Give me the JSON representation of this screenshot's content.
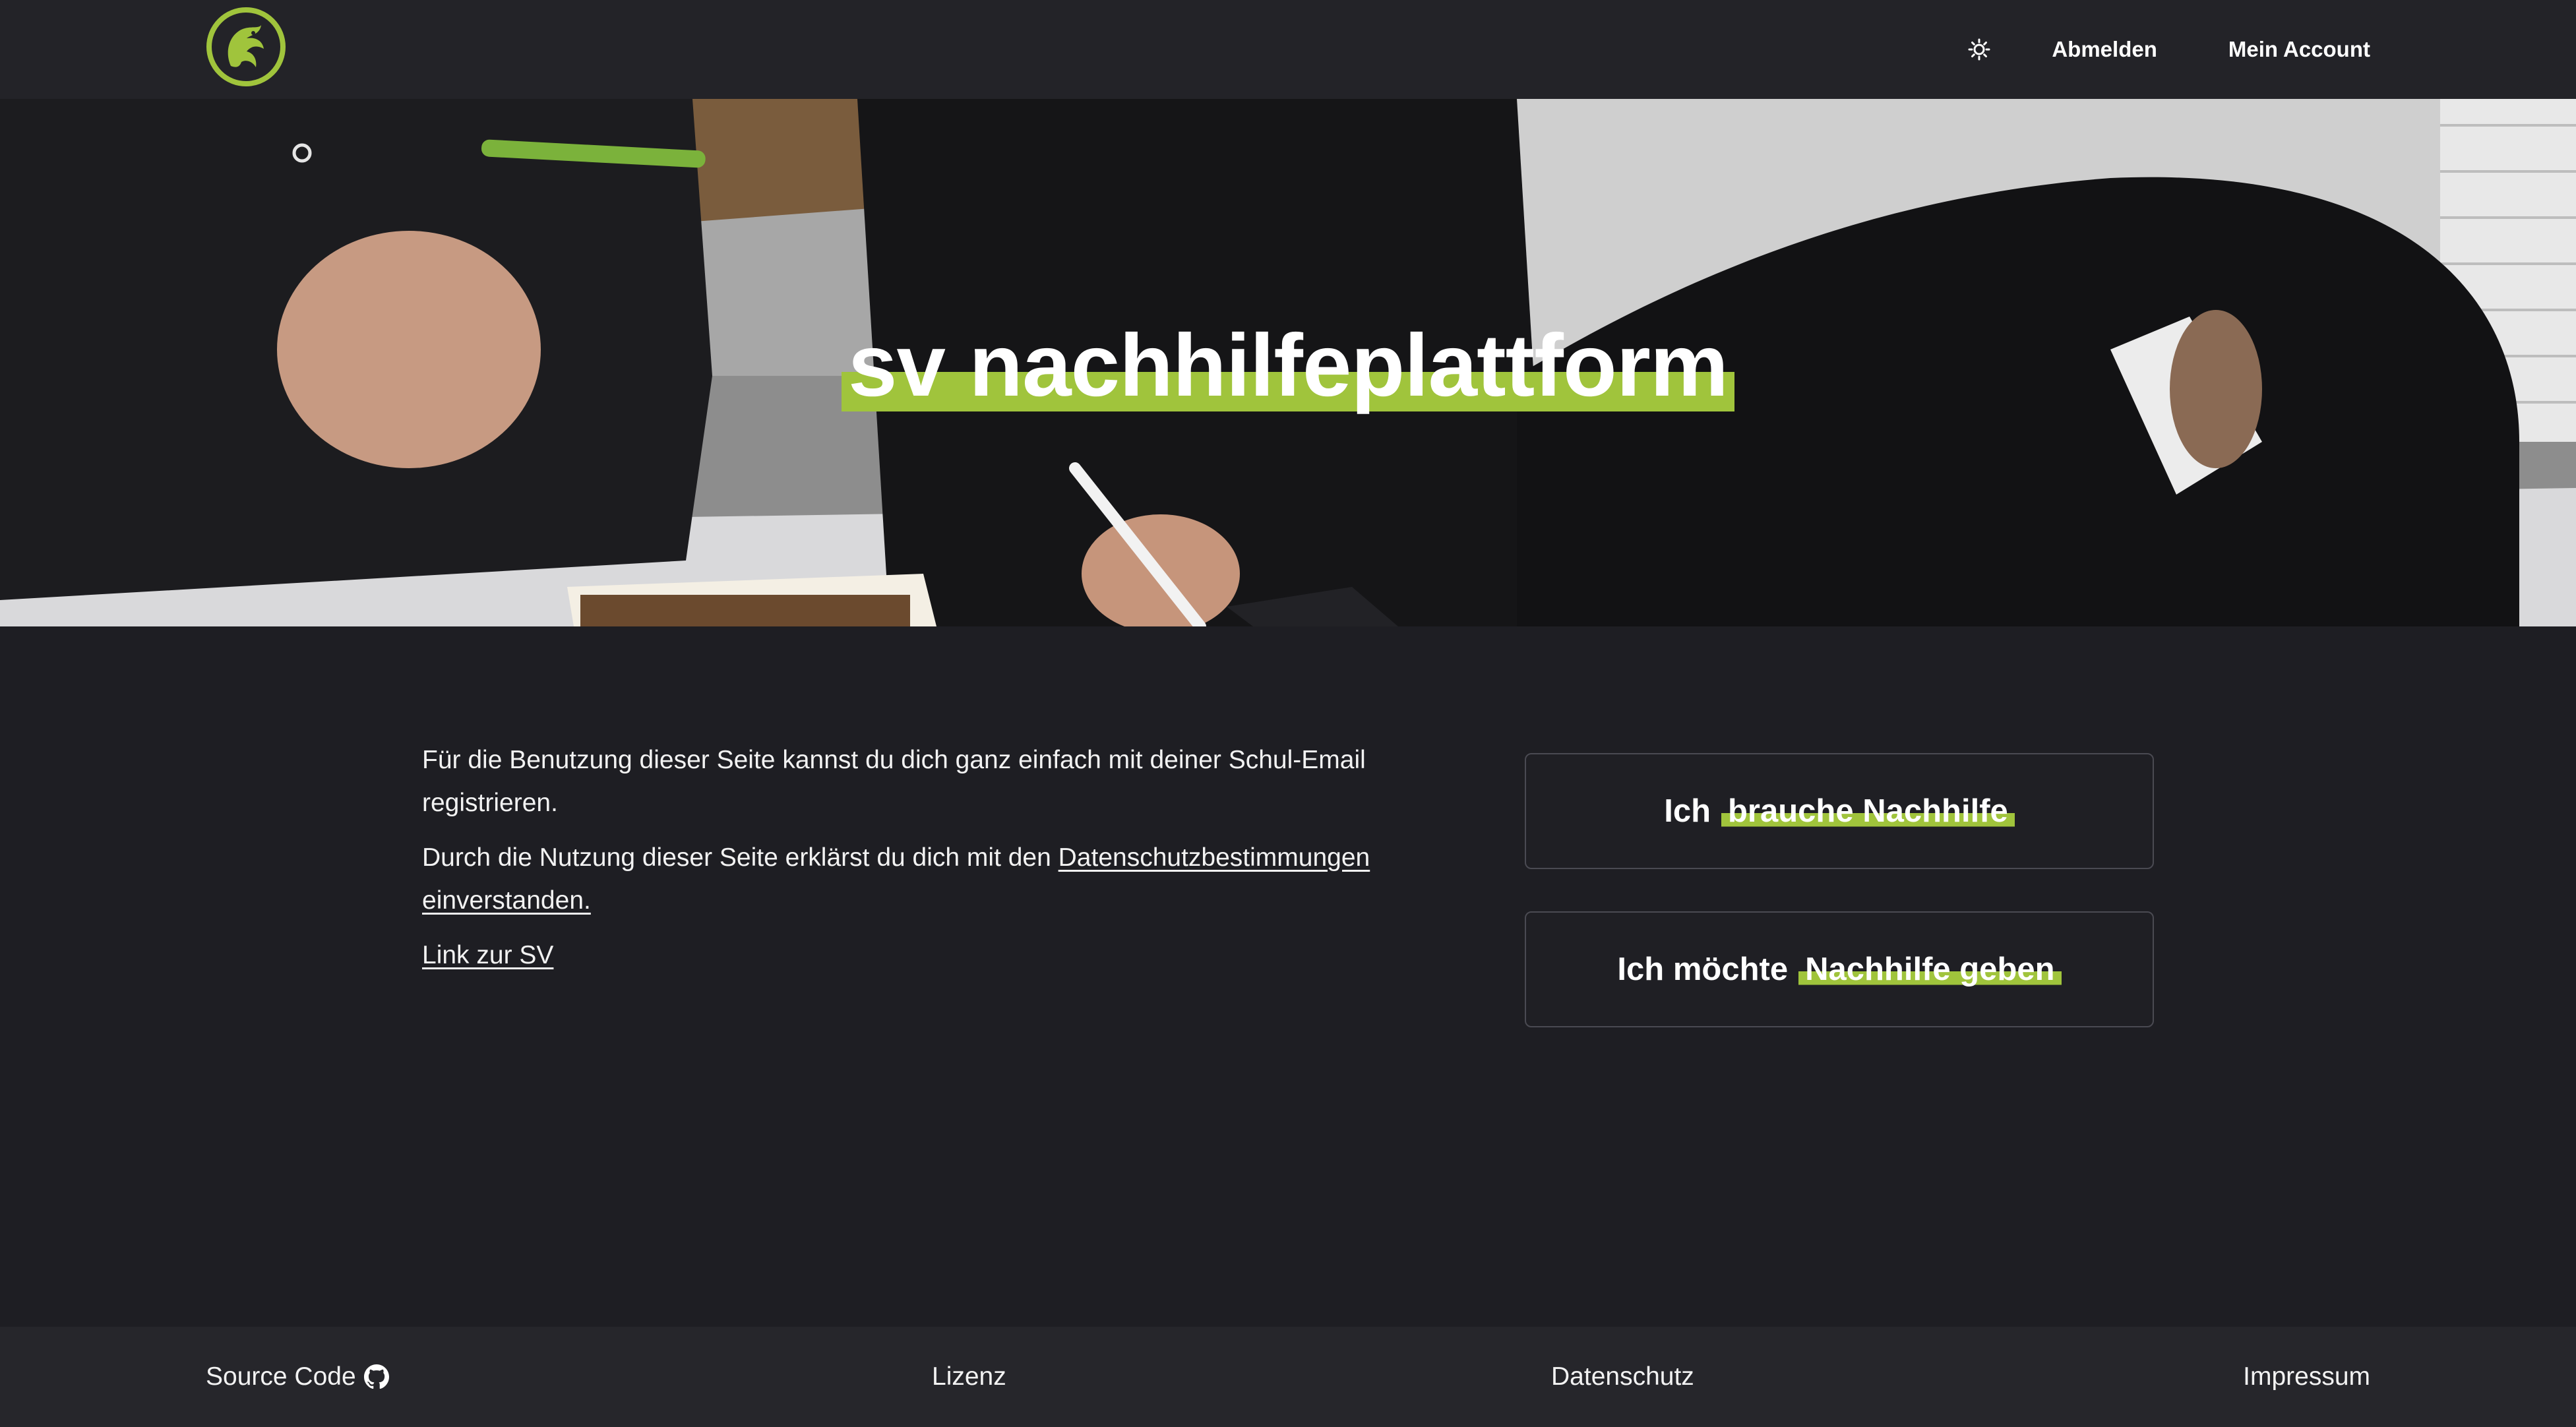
{
  "header": {
    "logo_icon": "phoenix-logo-icon",
    "theme_toggle_icon": "sun-icon",
    "logout_label": "Abmelden",
    "account_label": "Mein Account"
  },
  "hero": {
    "title": "sv nachhilfeplattform"
  },
  "info": {
    "p1": "Für die Benutzung dieser Seite kannst du dich ganz einfach mit deiner Schul-Email registrieren.",
    "p2_prefix": "Durch die Nutzung dieser Seite erklärst du dich mit den ",
    "p2_link": "Datenschutzbestimmungen einverstanden.",
    "sv_link": "Link zur SV"
  },
  "actions": {
    "need_prefix": "Ich",
    "need_highlight": "brauche Nachhilfe",
    "give_prefix": "Ich möchte",
    "give_highlight": "Nachhilfe geben"
  },
  "footer": {
    "source_label": "Source Code",
    "source_icon": "github-icon",
    "license_label": "Lizenz",
    "privacy_label": "Datenschutz",
    "imprint_label": "Impressum"
  },
  "colors": {
    "accent": "#a0c43c",
    "background": "#1e1e23",
    "header": "#232328"
  }
}
